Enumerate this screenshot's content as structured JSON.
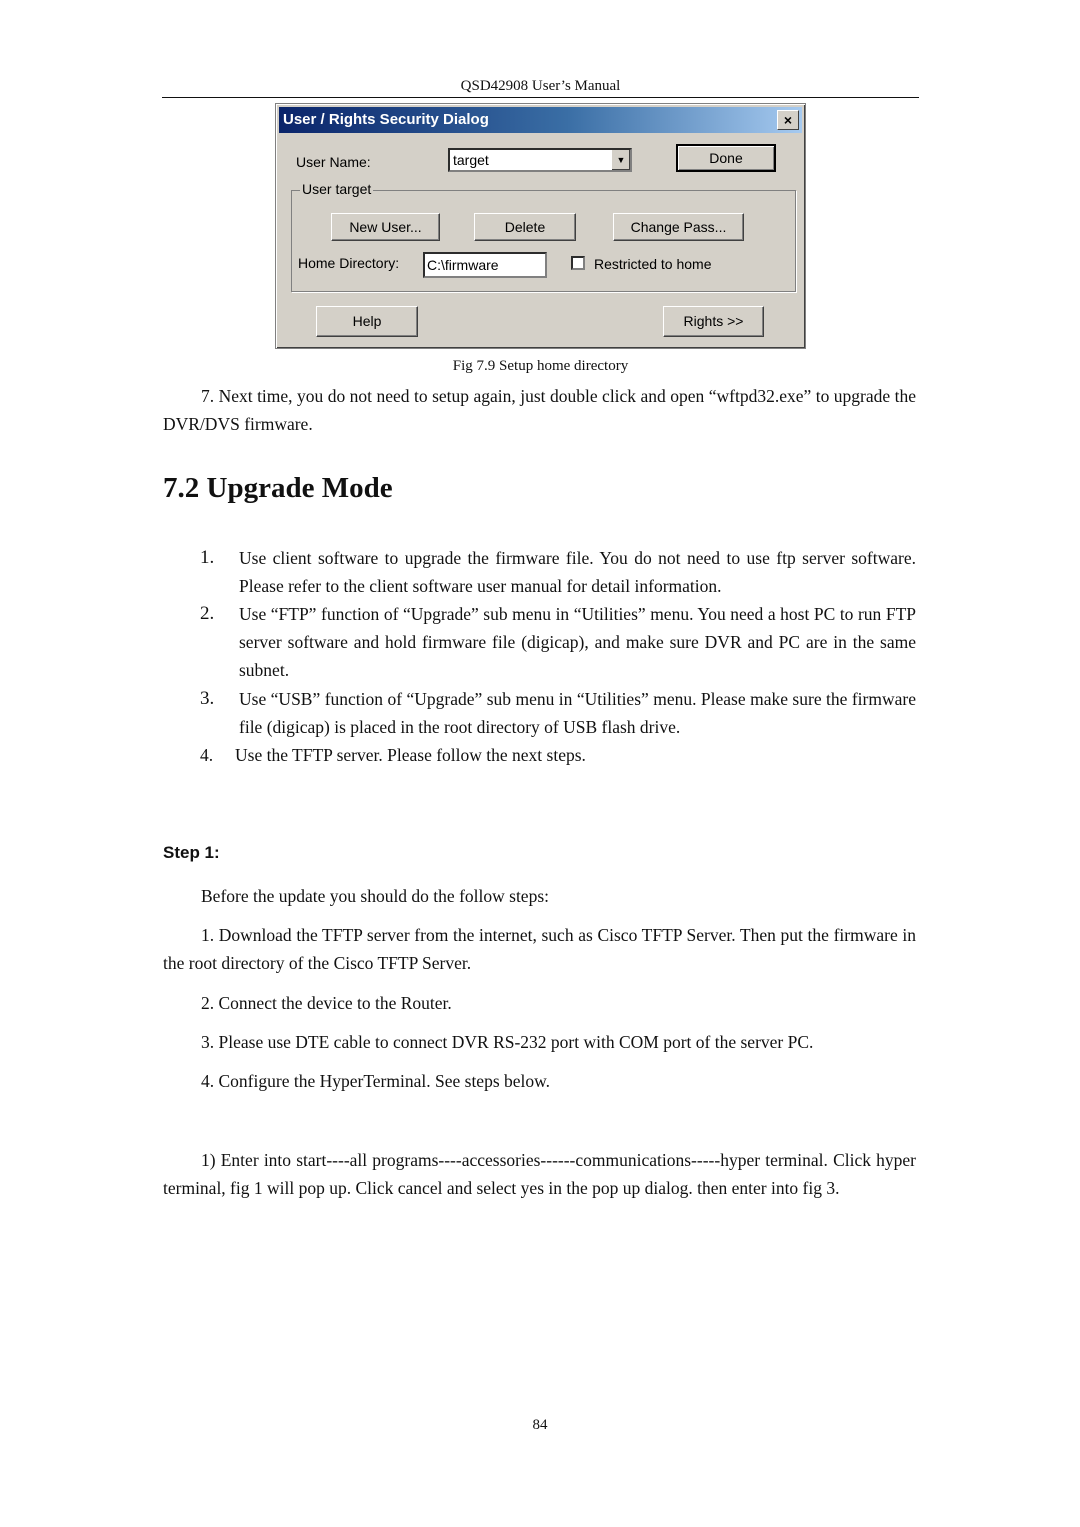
{
  "header": {
    "title": "QSD42908 User’s Manual"
  },
  "dialog": {
    "title": "User / Rights Security Dialog",
    "close_icon": "×",
    "user_name_label": "User Name:",
    "user_name_value": "target",
    "dropdown_icon": "▼",
    "done_label": "Done",
    "group_label": "User target",
    "new_user_label": "New User...",
    "delete_label": "Delete",
    "change_pass_label": "Change Pass...",
    "home_dir_label": "Home Directory:",
    "home_dir_value": "C:\\firmware",
    "restricted_label": "Restricted to home",
    "restricted_checked": false,
    "help_label": "Help",
    "rights_label": "Rights >>"
  },
  "figure_caption": "Fig 7.9 Setup home directory",
  "para_7": "7. Next time, you do not need to setup again, just double click and open “wftpd32.exe” to upgrade the DVR/DVS firmware.",
  "section": {
    "title": "7.2  Upgrade Mode"
  },
  "list": [
    {
      "num": "1.",
      "text": "Use client software to upgrade the firmware file. You do not need to use ftp server software. Please refer to the client software user manual for detail information."
    },
    {
      "num": "2.",
      "text": "Use “FTP” function of “Upgrade” sub menu in “Utilities” menu. You need a host PC to run FTP server software and hold firmware file (digicap), and make sure DVR and PC are in the same subnet."
    },
    {
      "num": "3.",
      "text": "Use “USB” function of “Upgrade” sub menu in “Utilities” menu. Please make sure the firmware file (digicap) is placed in the root directory of USB flash drive."
    },
    {
      "num": "4.",
      "text": "Use the TFTP server. Please follow the next steps."
    }
  ],
  "step1": {
    "heading": "Step 1:",
    "intro": "Before the update you should do the follow steps:",
    "items": [
      "1. Download the TFTP server from the internet, such as Cisco TFTP Server. Then put the firmware in the root directory of the Cisco TFTP Server.",
      "2. Connect the device to the Router.",
      "3. Please use DTE cable to connect DVR RS-232 port with COM port of the server PC.",
      "4. Configure the HyperTerminal. See steps below."
    ],
    "substep": "1) Enter into start----all programs----accessories------communications-----hyper terminal. Click hyper terminal,   fig 1 will pop up. Click cancel and select yes in the pop up dialog. then enter into fig 3."
  },
  "page_number": "84"
}
